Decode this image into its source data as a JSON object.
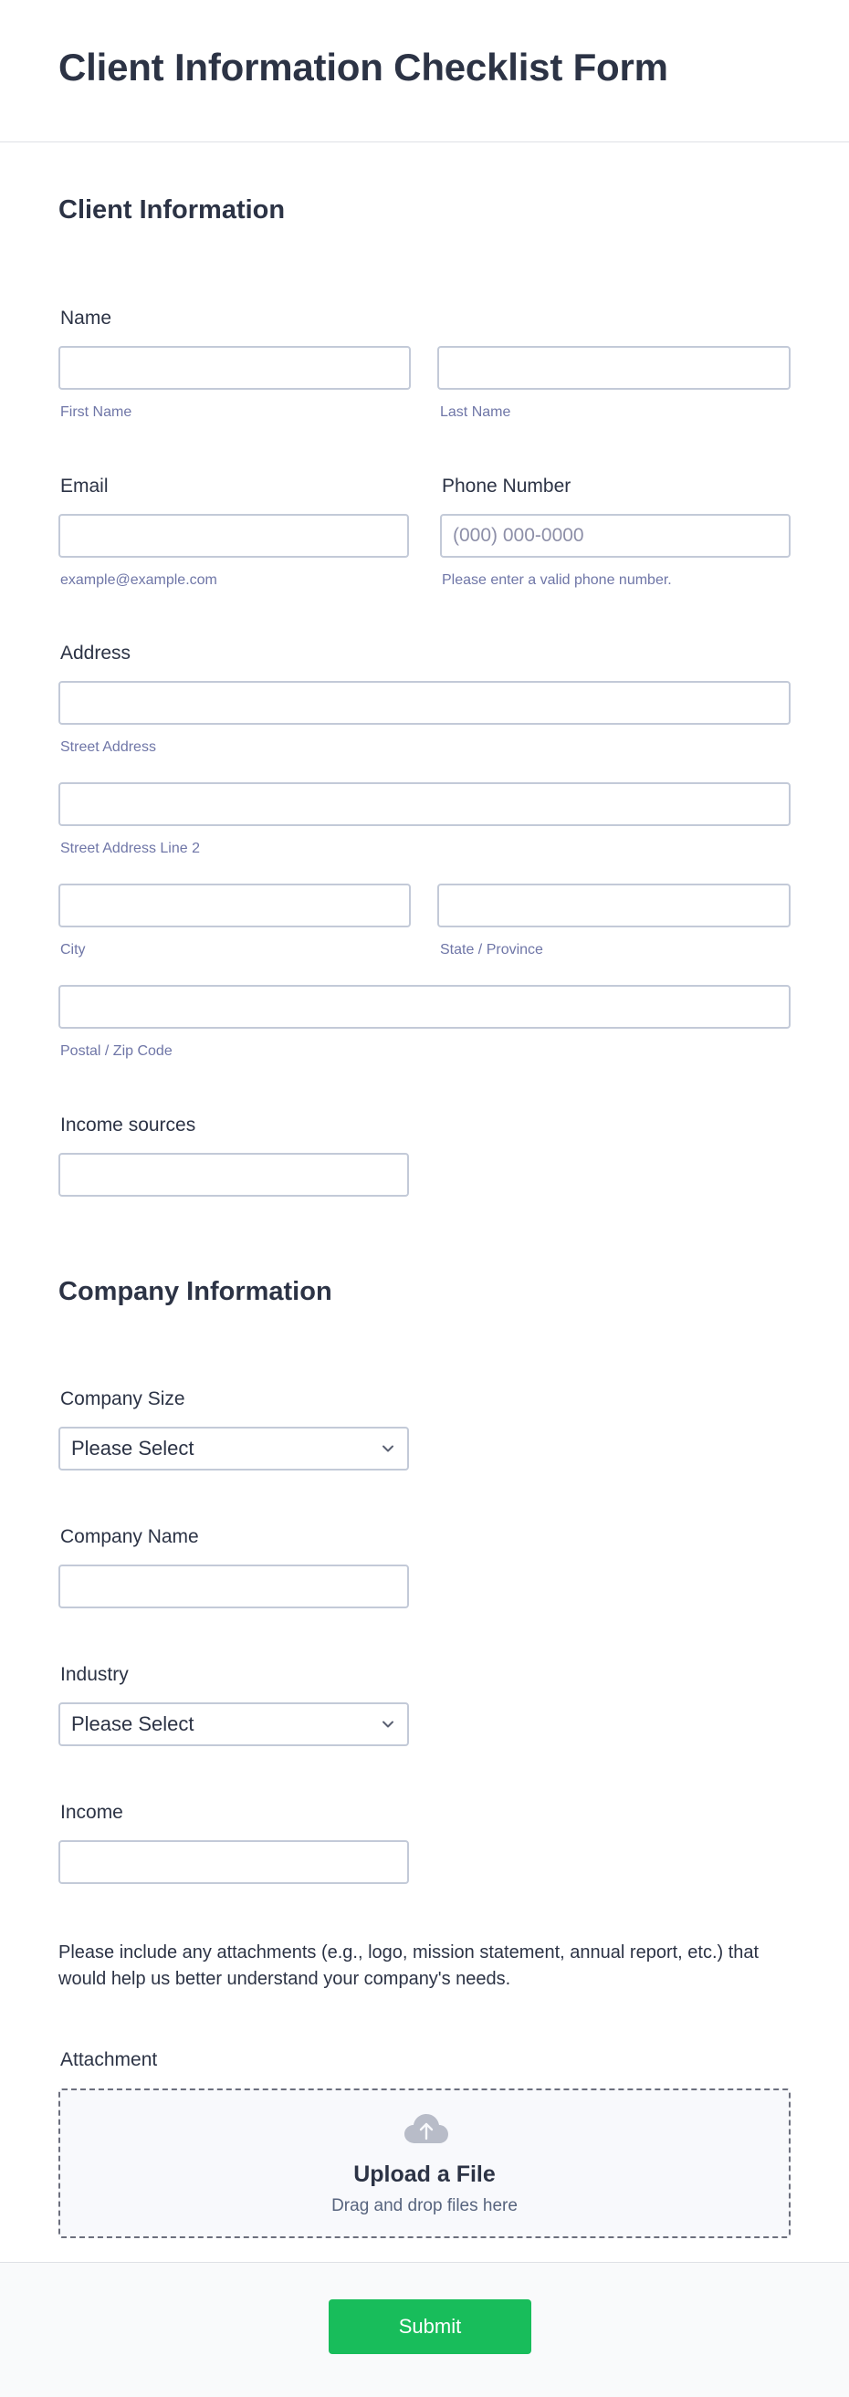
{
  "form": {
    "title": "Client Information Checklist Form"
  },
  "client_section": {
    "title": "Client Information",
    "name": {
      "label": "Name",
      "first_sublabel": "First Name",
      "last_sublabel": "Last Name",
      "first_value": "",
      "last_value": ""
    },
    "email": {
      "label": "Email",
      "sublabel": "example@example.com",
      "value": ""
    },
    "phone": {
      "label": "Phone Number",
      "placeholder": "(000) 000-0000",
      "sublabel": "Please enter a valid phone number.",
      "value": ""
    },
    "address": {
      "label": "Address",
      "street_sublabel": "Street Address",
      "street2_sublabel": "Street Address Line 2",
      "city_sublabel": "City",
      "state_sublabel": "State / Province",
      "zip_sublabel": "Postal / Zip Code"
    },
    "income_sources": {
      "label": "Income sources",
      "value": ""
    }
  },
  "company_section": {
    "title": "Company Information",
    "company_size": {
      "label": "Company Size",
      "selected": "Please Select"
    },
    "company_name": {
      "label": "Company Name",
      "value": ""
    },
    "industry": {
      "label": "Industry",
      "selected": "Please Select"
    },
    "income": {
      "label": "Income",
      "value": ""
    },
    "attachments_note": "Please include any attachments (e.g., logo, mission statement, annual report, etc.) that would help us better understand your company's needs.",
    "attachment": {
      "label": "Attachment",
      "upload_title": "Upload a File",
      "upload_subtitle": "Drag and drop files here",
      "icon": "cloud-upload-icon"
    }
  },
  "footer": {
    "submit_label": "Submit"
  },
  "colors": {
    "text": "#2c3345",
    "sublabel": "#6f76a7",
    "border": "#c3cad8",
    "submit": "#18bd5b",
    "upload_bg": "#f8f9fc"
  }
}
